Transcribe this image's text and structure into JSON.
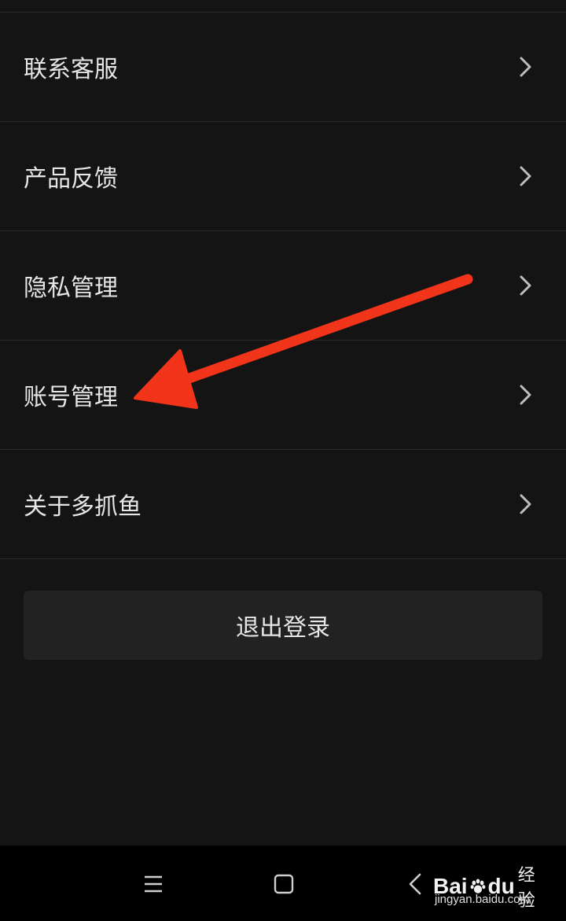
{
  "menu": {
    "items": [
      {
        "label": "联系客服"
      },
      {
        "label": "产品反馈"
      },
      {
        "label": "隐私管理"
      },
      {
        "label": "账号管理"
      },
      {
        "label": "关于多抓鱼"
      }
    ]
  },
  "logout": {
    "label": "退出登录"
  },
  "annotation": {
    "color": "#f2351a"
  },
  "watermark": {
    "logo_bai": "Bai",
    "logo_du": "du",
    "logo_jingyan": "经验",
    "url": "jingyan.baidu.com"
  },
  "navbar": {
    "icons": [
      "menu-icon",
      "home-icon",
      "back-icon"
    ]
  },
  "colors": {
    "background": "#141414",
    "divider": "#2a2a2a",
    "button_bg": "#222222",
    "text": "#e6e6e6",
    "navbar": "#000000"
  }
}
